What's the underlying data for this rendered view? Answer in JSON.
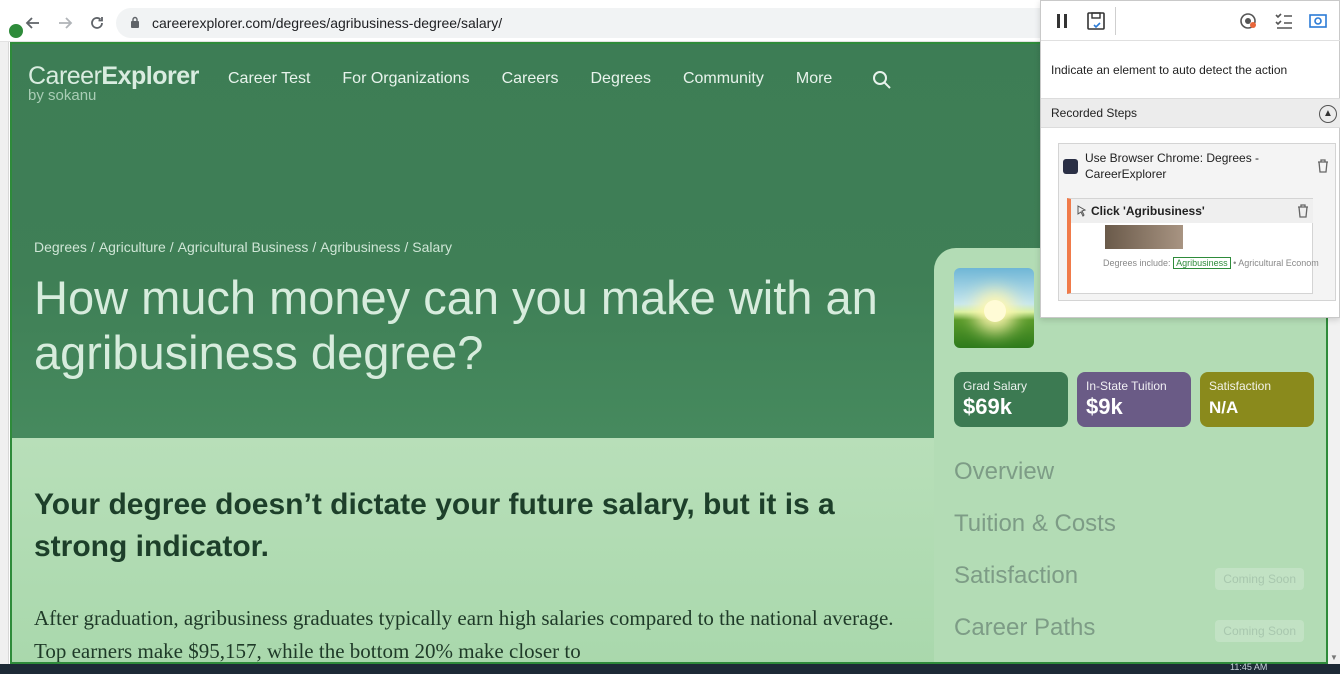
{
  "browser": {
    "url": "careerexplorer.com/degrees/agribusiness-degree/salary/",
    "back_icon": "arrow-left-icon",
    "forward_icon": "arrow-right-icon",
    "reload_icon": "reload-icon"
  },
  "site": {
    "logo_main_a": "Career",
    "logo_main_b": "Explorer",
    "logo_sub": "by sokanu",
    "nav": [
      "Career Test",
      "For Organizations",
      "Careers",
      "Degrees",
      "Community",
      "More"
    ]
  },
  "breadcrumb": [
    "Degrees",
    "/",
    "Agriculture",
    "/",
    "Agricultural Business",
    "/",
    "Agribusiness",
    "/",
    "Salary"
  ],
  "headline": "How much money can you make with an agribusiness degree?",
  "sub_headline": "Your degree doesn’t dictate your future salary, but it is a strong indicator.",
  "paragraph": "After graduation, agribusiness graduates typically earn high salaries compared to the national average. Top earners make $95,157, while the bottom 20% make closer to",
  "card": {
    "stats": [
      {
        "label": "Grad Salary",
        "value": "$69k"
      },
      {
        "label": "In-State Tuition",
        "value": "$9k"
      },
      {
        "label": "Satisfaction",
        "value": "N/A"
      }
    ],
    "menu": [
      {
        "label": "Overview",
        "badge": ""
      },
      {
        "label": "Tuition & Costs",
        "badge": ""
      },
      {
        "label": "Satisfaction",
        "badge": "Coming Soon"
      },
      {
        "label": "Career Paths",
        "badge": "Coming Soon"
      }
    ]
  },
  "recorder": {
    "indicate_text": "Indicate an element to auto detect the action",
    "steps_header": "Recorded Steps",
    "step_title": "Use Browser Chrome: Degrees - CareerExplorer",
    "sub_step_title": "Click 'Agribusiness'",
    "thumb_prefix": "Degrees include:",
    "thumb_highlight": "Agribusiness",
    "thumb_suffix": "• Agricultural Econom"
  },
  "taskbar": {
    "time": "11:45 AM"
  },
  "colors": {
    "hero": "#3f7f56",
    "lower": "#b3dcb5",
    "grad_salary": "#3c7a52",
    "tuition": "#6a5b86",
    "satisfaction": "#8a8a1c",
    "recorder_accent": "#f07b4a"
  }
}
